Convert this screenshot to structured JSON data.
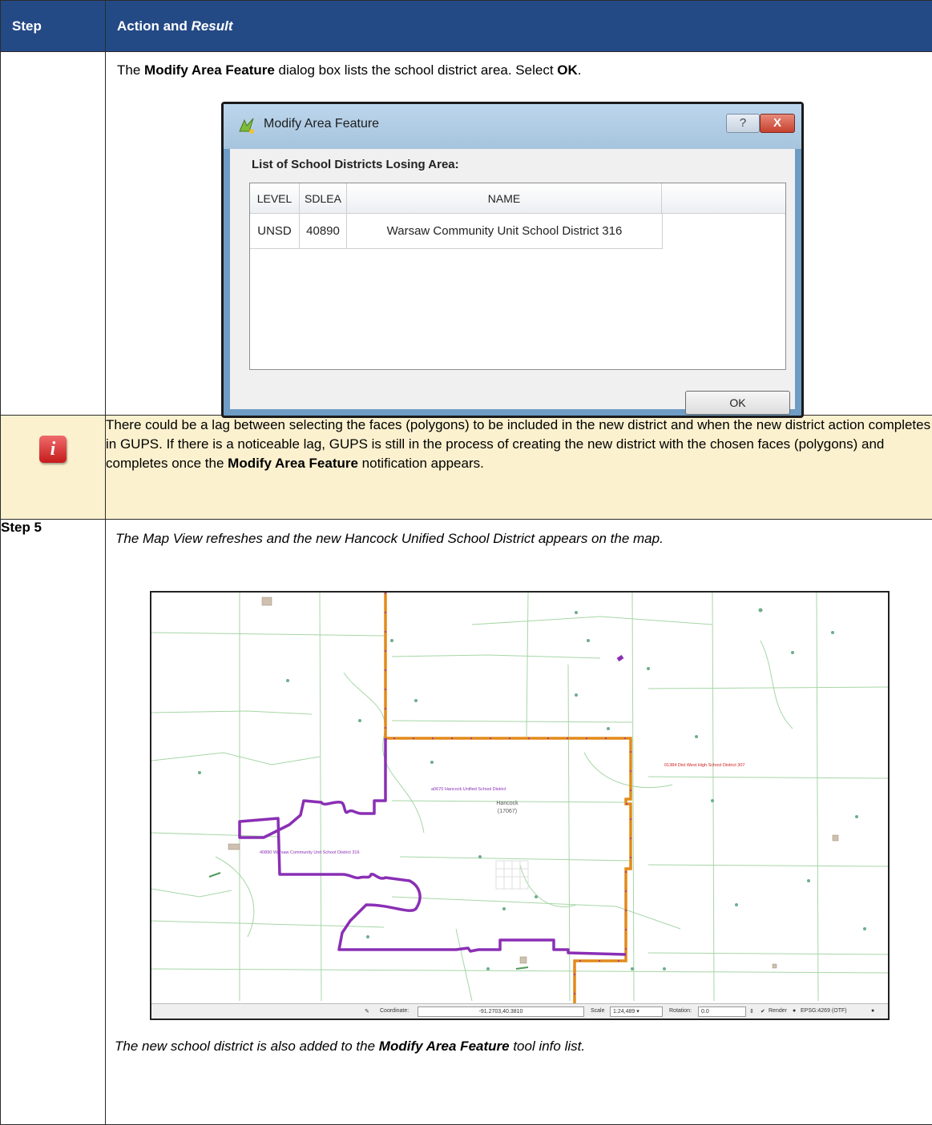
{
  "header": {
    "step": "Step",
    "action_prefix": "Action and ",
    "action_italic": "Result"
  },
  "row1": {
    "pre": "The ",
    "b1": "Modify Area Feature",
    "mid": " dialog box lists the school district area. Select ",
    "b2": "OK",
    "post": "."
  },
  "dialog": {
    "title": "Modify Area Feature",
    "help_glyph": "?",
    "close_glyph": "X",
    "list_label": "List of School Districts Losing Area:",
    "columns": [
      "LEVEL",
      "SDLEA",
      "NAME"
    ],
    "rows": [
      {
        "level": "UNSD",
        "sdlea": "40890",
        "name": "Warsaw Community Unit School District 316"
      }
    ],
    "ok": "OK"
  },
  "note": {
    "text1": "There could be a lag between selecting the faces (polygons) to be included in the new district and when the new district action completes in GUPS. If there is a noticeable lag, GUPS is still in the process of creating the new district with the chosen faces (polygons) and completes once the ",
    "bold": "Modify Area Feature",
    "text2": " notification appears."
  },
  "step5": {
    "label": "Step 5",
    "result": "The Map View refreshes and the new Hancock Unified School District appears on the map.",
    "bottom_pre": "The new school district is also added to the ",
    "bottom_bold": "Modify Area Feature",
    "bottom_post": " tool info list."
  },
  "map": {
    "labels": {
      "hancock_district": "a0670 Hancock Unified School District",
      "county": "Hancock",
      "county_code": "(17067)",
      "warsaw": "40890 Warsaw Community Unit School District 316",
      "dist307": "01384 Dist West High School District 307"
    },
    "status": {
      "coord_label": "Coordinate:",
      "coord_value": "-91.2703,40.3810",
      "scale_label": "Scale",
      "scale_value": "1:24,489",
      "rotation_label": "Rotation:",
      "rotation_value": "0.0",
      "render": "Render",
      "crs": "EPSG:4269 (OTF)"
    },
    "colors": {
      "district_boundary": "#8a2fb5",
      "county_boundary": "#e38a1a",
      "base_lines": "#a6d6a6"
    }
  }
}
